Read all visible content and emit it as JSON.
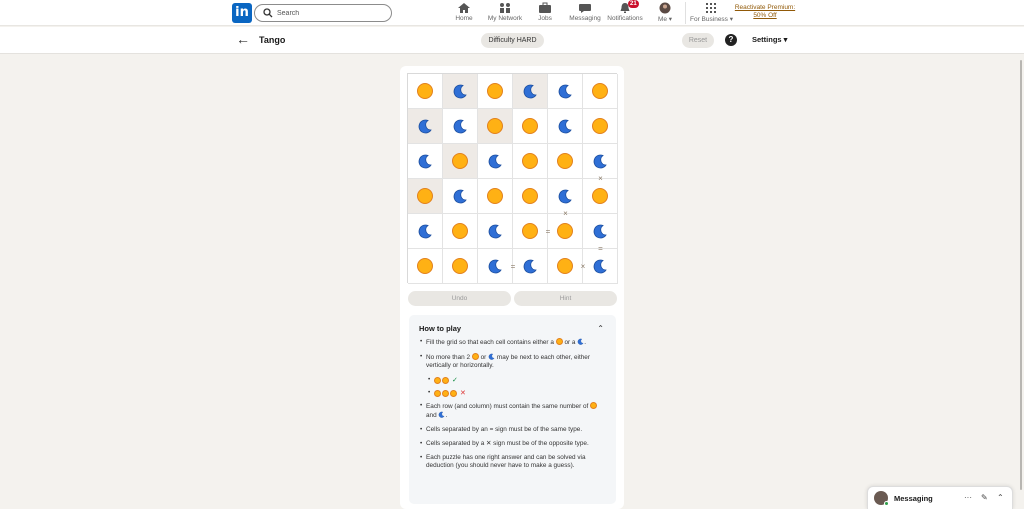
{
  "nav": {
    "search_placeholder": "Search",
    "items": [
      {
        "label": "Home",
        "icon": "home-icon"
      },
      {
        "label": "My Network",
        "icon": "network-icon"
      },
      {
        "label": "Jobs",
        "icon": "briefcase-icon"
      },
      {
        "label": "Messaging",
        "icon": "chat-icon"
      },
      {
        "label": "Notifications",
        "icon": "bell-icon",
        "badge": "21"
      },
      {
        "label": "Me ▾",
        "icon": "avatar"
      },
      {
        "label": "For Business ▾",
        "icon": "grid-icon"
      }
    ],
    "premium_line1": "Reactivate Premium:",
    "premium_line2": "50% Off"
  },
  "subheader": {
    "title": "Tango",
    "difficulty": "Difficulty HARD",
    "reset": "Reset",
    "help": "?",
    "settings": "Settings ▾"
  },
  "game": {
    "grid": [
      [
        "sun",
        "moon",
        "sun",
        "moon",
        "moon",
        "sun"
      ],
      [
        "moon",
        "moon",
        "sun",
        "sun",
        "moon",
        "sun"
      ],
      [
        "moon",
        "sun",
        "moon",
        "sun",
        "sun",
        "moon"
      ],
      [
        "sun",
        "moon",
        "sun",
        "sun",
        "moon",
        "sun"
      ],
      [
        "moon",
        "sun",
        "moon",
        "sun",
        "sun",
        "moon"
      ],
      [
        "sun",
        "sun",
        "moon",
        "moon",
        "sun",
        "moon"
      ]
    ],
    "locked": [
      [
        0,
        1
      ],
      [
        0,
        3
      ],
      [
        1,
        0
      ],
      [
        1,
        2
      ],
      [
        2,
        1
      ],
      [
        3,
        0
      ]
    ],
    "constraints": [
      {
        "symbol": "×",
        "between": [
          [
            2,
            5
          ],
          [
            3,
            5
          ]
        ]
      },
      {
        "symbol": "×",
        "between": [
          [
            3,
            4
          ],
          [
            4,
            4
          ]
        ]
      },
      {
        "symbol": "=",
        "between": [
          [
            4,
            3
          ],
          [
            4,
            4
          ]
        ]
      },
      {
        "symbol": "=",
        "between": [
          [
            4,
            5
          ],
          [
            5,
            5
          ]
        ]
      },
      {
        "symbol": "=",
        "between": [
          [
            5,
            2
          ],
          [
            5,
            3
          ]
        ]
      },
      {
        "symbol": "×",
        "between": [
          [
            5,
            4
          ],
          [
            5,
            5
          ]
        ]
      }
    ],
    "colors": {
      "sun": "#ffb114",
      "sun_border": "#e2811f",
      "moon": "#2f6fd6",
      "locked_bg": "#eeeae6"
    },
    "undo": "Undo",
    "hint": "Hint"
  },
  "howto": {
    "title": "How to play",
    "rule1_a": "Fill the grid so that each cell contains either a",
    "rule1_b": "or a",
    "rule1_c": ".",
    "rule2_a": "No more than 2",
    "rule2_b": "or",
    "rule2_c": "may be next to each other, either vertically or horizontally.",
    "ex_ok": "✓",
    "ex_bad": "✕",
    "rule3_a": "Each row (and column) must contain the same number of",
    "rule3_b": "and",
    "rule3_c": ".",
    "rule4": "Cells separated by an = sign must be of the same type.",
    "rule5": "Cells separated by a ✕ sign must be of the opposite type.",
    "rule6": "Each puzzle has one right answer and can be solved via deduction (you should never have to make a guess)."
  },
  "messaging": {
    "title": "Messaging",
    "more": "···"
  }
}
